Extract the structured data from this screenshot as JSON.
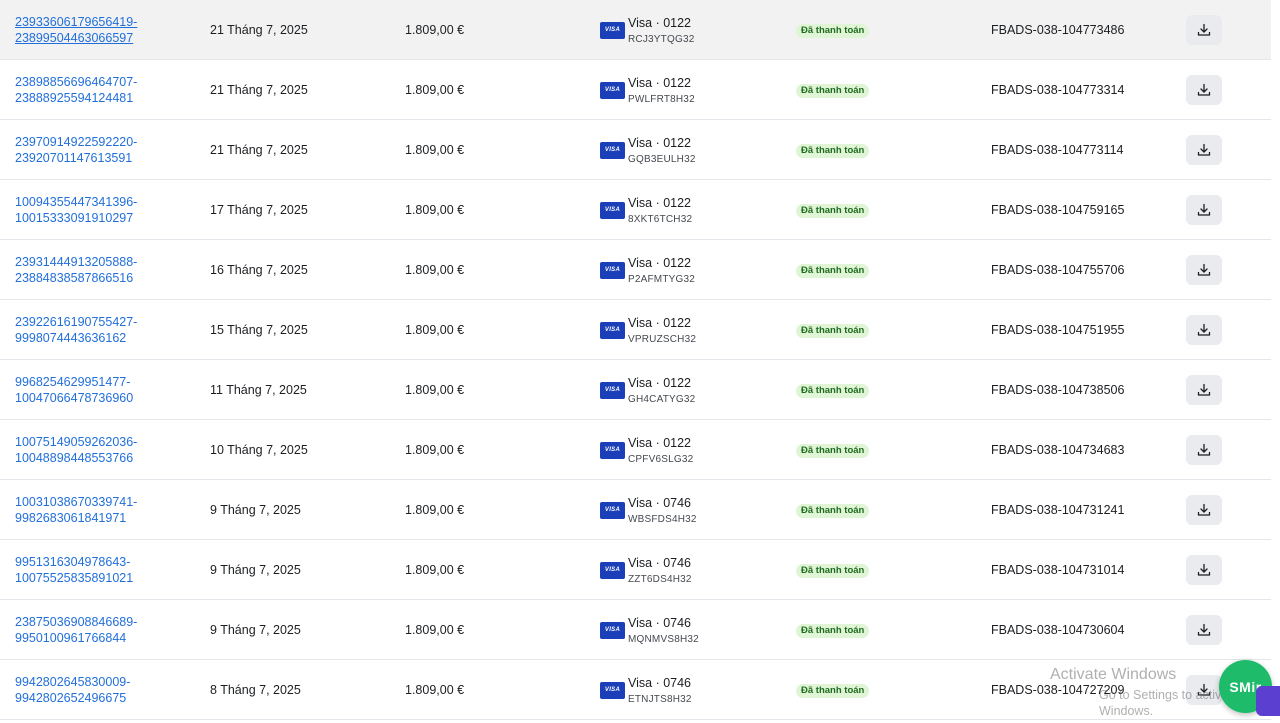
{
  "rows": [
    {
      "txn1": "23933606179656419-",
      "txn2": "23899504463066597",
      "date": "21 Tháng 7, 2025",
      "amount": "1.809,00 €",
      "visa_label": "VISA",
      "method": "Visa · 0122",
      "method_ref": "RCJ3YTQG32",
      "status": "Đã thanh toán",
      "ref": "FBADS-038-104773486"
    },
    {
      "txn1": "23898856696464707-",
      "txn2": "23888925594124481",
      "date": "21 Tháng 7, 2025",
      "amount": "1.809,00 €",
      "visa_label": "VISA",
      "method": "Visa · 0122",
      "method_ref": "PWLFRT8H32",
      "status": "Đã thanh toán",
      "ref": "FBADS-038-104773314"
    },
    {
      "txn1": "23970914922592220-",
      "txn2": "23920701147613591",
      "date": "21 Tháng 7, 2025",
      "amount": "1.809,00 €",
      "visa_label": "VISA",
      "method": "Visa · 0122",
      "method_ref": "GQB3EULH32",
      "status": "Đã thanh toán",
      "ref": "FBADS-038-104773114"
    },
    {
      "txn1": "10094355447341396-",
      "txn2": "10015333091910297",
      "date": "17 Tháng 7, 2025",
      "amount": "1.809,00 €",
      "visa_label": "VISA",
      "method": "Visa · 0122",
      "method_ref": "8XKT6TCH32",
      "status": "Đã thanh toán",
      "ref": "FBADS-038-104759165"
    },
    {
      "txn1": "23931444913205888-",
      "txn2": "23884838587866516",
      "date": "16 Tháng 7, 2025",
      "amount": "1.809,00 €",
      "visa_label": "VISA",
      "method": "Visa · 0122",
      "method_ref": "P2AFMTYG32",
      "status": "Đã thanh toán",
      "ref": "FBADS-038-104755706"
    },
    {
      "txn1": "23922616190755427-",
      "txn2": "9998074443636162",
      "date": "15 Tháng 7, 2025",
      "amount": "1.809,00 €",
      "visa_label": "VISA",
      "method": "Visa · 0122",
      "method_ref": "VPRUZSCH32",
      "status": "Đã thanh toán",
      "ref": "FBADS-038-104751955"
    },
    {
      "txn1": "9968254629951477-",
      "txn2": "10047066478736960",
      "date": "11 Tháng 7, 2025",
      "amount": "1.809,00 €",
      "visa_label": "VISA",
      "method": "Visa · 0122",
      "method_ref": "GH4CATYG32",
      "status": "Đã thanh toán",
      "ref": "FBADS-038-104738506"
    },
    {
      "txn1": "10075149059262036-",
      "txn2": "10048898448553766",
      "date": "10 Tháng 7, 2025",
      "amount": "1.809,00 €",
      "visa_label": "VISA",
      "method": "Visa · 0122",
      "method_ref": "CPFV6SLG32",
      "status": "Đã thanh toán",
      "ref": "FBADS-038-104734683"
    },
    {
      "txn1": "10031038670339741-",
      "txn2": "9982683061841971",
      "date": "9 Tháng 7, 2025",
      "amount": "1.809,00 €",
      "visa_label": "VISA",
      "method": "Visa · 0746",
      "method_ref": "WBSFDS4H32",
      "status": "Đã thanh toán",
      "ref": "FBADS-038-104731241"
    },
    {
      "txn1": "9951316304978643-",
      "txn2": "10075525835891021",
      "date": "9 Tháng 7, 2025",
      "amount": "1.809,00 €",
      "visa_label": "VISA",
      "method": "Visa · 0746",
      "method_ref": "ZZT6DS4H32",
      "status": "Đã thanh toán",
      "ref": "FBADS-038-104731014"
    },
    {
      "txn1": "23875036908846689-",
      "txn2": "9950100961766844",
      "date": "9 Tháng 7, 2025",
      "amount": "1.809,00 €",
      "visa_label": "VISA",
      "method": "Visa · 0746",
      "method_ref": "MQNMVS8H32",
      "status": "Đã thanh toán",
      "ref": "FBADS-038-104730604"
    },
    {
      "txn1": "9942802645830009-",
      "txn2": "9942802652496675",
      "date": "8 Tháng 7, 2025",
      "amount": "1.809,00 €",
      "visa_label": "VISA",
      "method": "Visa · 0746",
      "method_ref": "ETNJTS8H32",
      "status": "Đã thanh toán",
      "ref": "FBADS-038-104727209"
    }
  ],
  "icons": {
    "download": "download-icon"
  },
  "colors": {
    "link": "#216fdb",
    "status_bg": "#dff5d5",
    "status_text": "#1f6b1f",
    "visa_bg": "#1a3fb8",
    "smir_bg": "#1dbb6a"
  },
  "watermark": {
    "title": "Activate Windows",
    "subtitle": "Go to Settings to activate Windows."
  },
  "smir_button": {
    "label": "SMir"
  }
}
